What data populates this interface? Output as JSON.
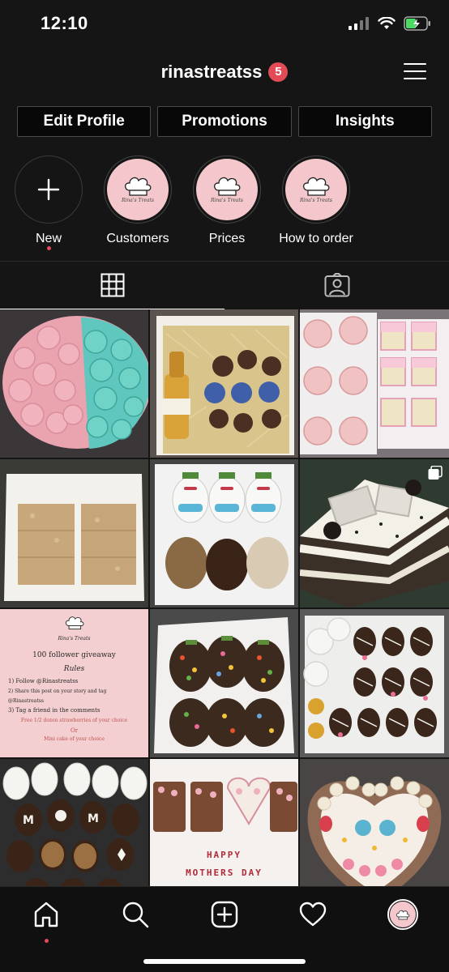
{
  "status_bar": {
    "time": "12:10"
  },
  "header": {
    "username": "rinastreatss",
    "notification_count": "5"
  },
  "actions": {
    "edit_profile": "Edit Profile",
    "promotions": "Promotions",
    "insights": "Insights"
  },
  "highlights": [
    {
      "label": "New",
      "type": "add"
    },
    {
      "label": "Customers",
      "type": "logo"
    },
    {
      "label": "Prices",
      "type": "logo"
    },
    {
      "label": "How to order",
      "type": "logo"
    }
  ],
  "logo_caption": "Rina's Treats",
  "tabs": [
    "posts-grid",
    "tagged"
  ],
  "giveaway_post": {
    "brand": "Rina's Treats",
    "title": "100 follower giveaway",
    "rules_heading": "Rules",
    "rule_1": "1) Follow @Rinastreatss",
    "rule_2": "2) Share this post on your story and tag @Rinastreatss",
    "rule_3": "3) Tag a friend in the comments",
    "prize_1": "Free 1/2 dozen strawberries of your choice",
    "or": "Or",
    "prize_2": "Mini cake of your choice"
  },
  "mothers_day_post": {
    "line1": "HAPPY",
    "line2": "MOTHERS DAY"
  },
  "colors": {
    "accent": "#e34b56",
    "background": "#151515",
    "logo_pink": "#f3c7cb"
  }
}
